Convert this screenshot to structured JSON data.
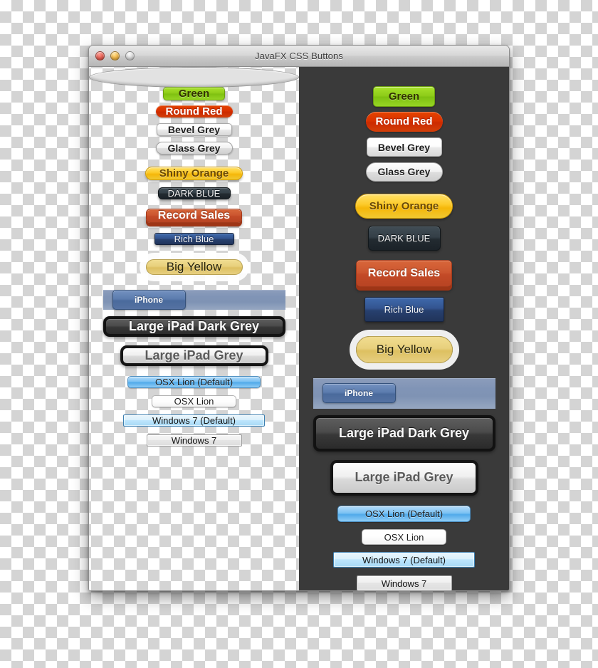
{
  "window": {
    "title": "JavaFX CSS Buttons",
    "traffic_lights": [
      {
        "name": "close-button",
        "color": "#ec6a5e"
      },
      {
        "name": "minimize-button",
        "color": "#f6bd50"
      },
      {
        "name": "zoom-button",
        "color": "#dcdcdc"
      }
    ]
  },
  "panels": [
    {
      "id": "light",
      "background": "#e2e2e2"
    },
    {
      "id": "dark",
      "background": "#3a3a3a"
    }
  ],
  "buttons": [
    {
      "key": "green",
      "label": "Green",
      "class": "b-green",
      "text_color": "#333300",
      "fill": "#8dcb18"
    },
    {
      "key": "round_red",
      "label": "Round Red",
      "class": "b-roundred",
      "text_color": "#ffffff",
      "fill": "#d93200"
    },
    {
      "key": "bevel_grey",
      "label": "Bevel Grey",
      "class": "b-bevel",
      "text_color": "#1d1d1d",
      "fill": "#f2f2f2"
    },
    {
      "key": "glass_grey",
      "label": "Glass Grey",
      "class": "b-glass",
      "text_color": "#1d1d1d",
      "fill": "#e8e8e8"
    },
    {
      "key": "shiny_orange",
      "label": "Shiny Orange",
      "class": "b-shiny",
      "text_color": "#6b4a05",
      "fill": "#fdcb2b"
    },
    {
      "key": "dark_blue",
      "label": "DARK BLUE",
      "class": "b-darkblue",
      "text_color": "#f0f0f0",
      "fill": "#2b343b"
    },
    {
      "key": "record_sales",
      "label": "Record Sales",
      "class": "b-record",
      "text_color": "#ffffff",
      "fill": "#cc5630"
    },
    {
      "key": "rich_blue",
      "label": "Rich Blue",
      "class": "b-richblue",
      "text_color": "#f2f4f8",
      "fill": "#2b4678"
    },
    {
      "key": "big_yellow",
      "label": "Big Yellow",
      "class": "b-bigyellow",
      "text_color": "#262208",
      "fill": "#e3c96f"
    },
    {
      "key": "iphone",
      "label": "iPhone",
      "class": "b-iphone",
      "text_color": "#ffffff",
      "fill": "#5c7cae"
    },
    {
      "key": "ipad_dark",
      "label": "Large iPad Dark Grey",
      "class": "b-ipaddark",
      "text_color": "#fafafa",
      "fill": "#3f3f3f"
    },
    {
      "key": "ipad_grey",
      "label": "Large iPad Grey",
      "class": "b-ipadgrey",
      "text_color": "#5a5a5a",
      "fill": "#e6e6e6"
    },
    {
      "key": "osx_default",
      "label": "OSX Lion (Default)",
      "class": "b-osxdef",
      "text_color": "#1c1c1c",
      "fill": "#7bc1f3"
    },
    {
      "key": "osx",
      "label": "OSX Lion",
      "class": "b-osx",
      "text_color": "#1c1c1c",
      "fill": "#fdfdfd"
    },
    {
      "key": "win_default",
      "label": "Windows 7 (Default)",
      "class": "b-windef",
      "text_color": "#111111",
      "fill": "#bee6fd"
    },
    {
      "key": "win",
      "label": "Windows 7",
      "class": "b-win",
      "text_color": "#111111",
      "fill": "#e9e9e9"
    }
  ]
}
